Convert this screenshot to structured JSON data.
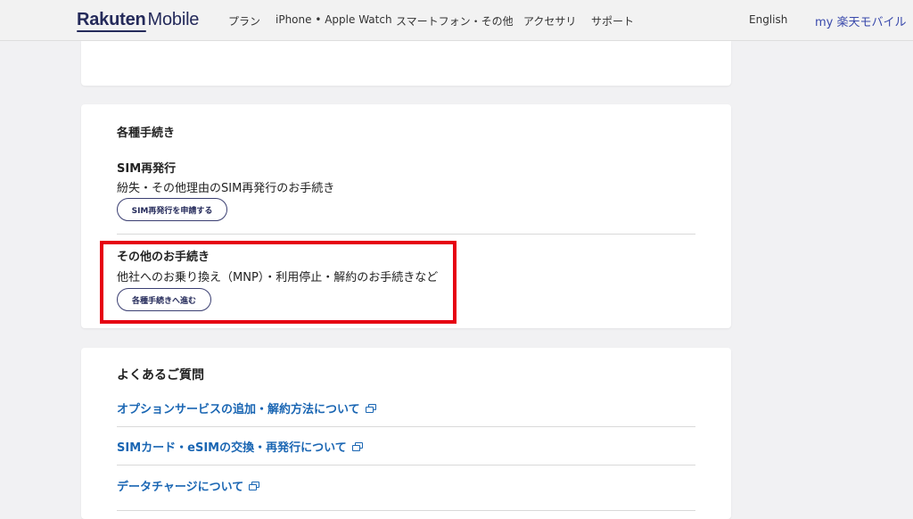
{
  "header": {
    "logo_brand": "Rakuten",
    "logo_sub": "Mobile",
    "nav": [
      "プラン",
      "iPhone • Apple Watch",
      "スマートフォン・その他",
      "アクセサリ",
      "サポート"
    ],
    "lang": "English",
    "my": "my 楽天モバイル"
  },
  "procedures": {
    "title": "各種手続き",
    "sim": {
      "title": "SIM再発行",
      "desc": "紛失・その他理由のSIM再発行のお手続き",
      "button": "SIM再発行を申請する"
    },
    "other": {
      "title": "その他のお手続き",
      "desc": "他社へのお乗り換え（MNP）・利用停止・解約のお手続きなど",
      "button": "各種手続きへ進む"
    }
  },
  "faq": {
    "title": "よくあるご質問",
    "links": [
      "オプションサービスの追加・解約方法について",
      "SIMカード・eSIMの交換・再発行について",
      "データチャージについて"
    ]
  },
  "colors": {
    "brand_navy": "#242a5a",
    "link_blue": "#1a66b3",
    "highlight_red": "#e60012"
  }
}
